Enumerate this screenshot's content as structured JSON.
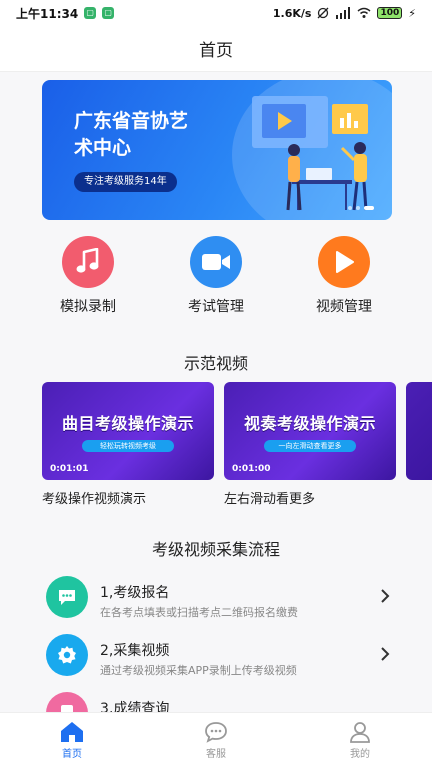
{
  "status_bar": {
    "time": "上午11:34",
    "speed": "1.6K/s",
    "battery": "100"
  },
  "header": {
    "title": "首页"
  },
  "banner": {
    "headline": "广东省音协艺术中心",
    "tagline": "专注考级服务14年"
  },
  "actions": [
    {
      "label": "模拟录制",
      "icon": "music-note-icon",
      "color": "#f25c6e"
    },
    {
      "label": "考试管理",
      "icon": "video-camera-icon",
      "color": "#2f8ef2"
    },
    {
      "label": "视频管理",
      "icon": "play-icon",
      "color": "#ff7a1e"
    }
  ],
  "demo_section": {
    "title": "示范视频"
  },
  "videos": [
    {
      "thumb_title": "曲目考级操作演示",
      "thumb_sub": "轻松玩转视频考级",
      "duration": "0:01:01",
      "title": "考级操作视频演示"
    },
    {
      "thumb_title": "视奏考级操作演示",
      "thumb_sub": "一向左滑动查看更多",
      "duration": "0:01:00",
      "title": "左右滑动看更多"
    }
  ],
  "process_section": {
    "title": "考级视频采集流程"
  },
  "steps": [
    {
      "name": "1,考级报名",
      "desc": "在各考点填表或扫描考点二维码报名缴费",
      "icon": "chat-icon",
      "color": "#1fc4a0"
    },
    {
      "name": "2,采集视频",
      "desc": "通过考级视频采集APP录制上传考级视频",
      "icon": "gear-icon",
      "color": "#19a9ee"
    },
    {
      "name": "3,成绩查询",
      "desc": "",
      "icon": "document-icon",
      "color": "#f06aa0"
    }
  ],
  "tabbar": [
    {
      "label": "首页",
      "icon": "home-icon",
      "active": true
    },
    {
      "label": "客服",
      "icon": "chat-bubble-icon",
      "active": false
    },
    {
      "label": "我的",
      "icon": "user-icon",
      "active": false
    }
  ],
  "colors": {
    "accent": "#1e6ff0",
    "inactive": "#999999"
  }
}
